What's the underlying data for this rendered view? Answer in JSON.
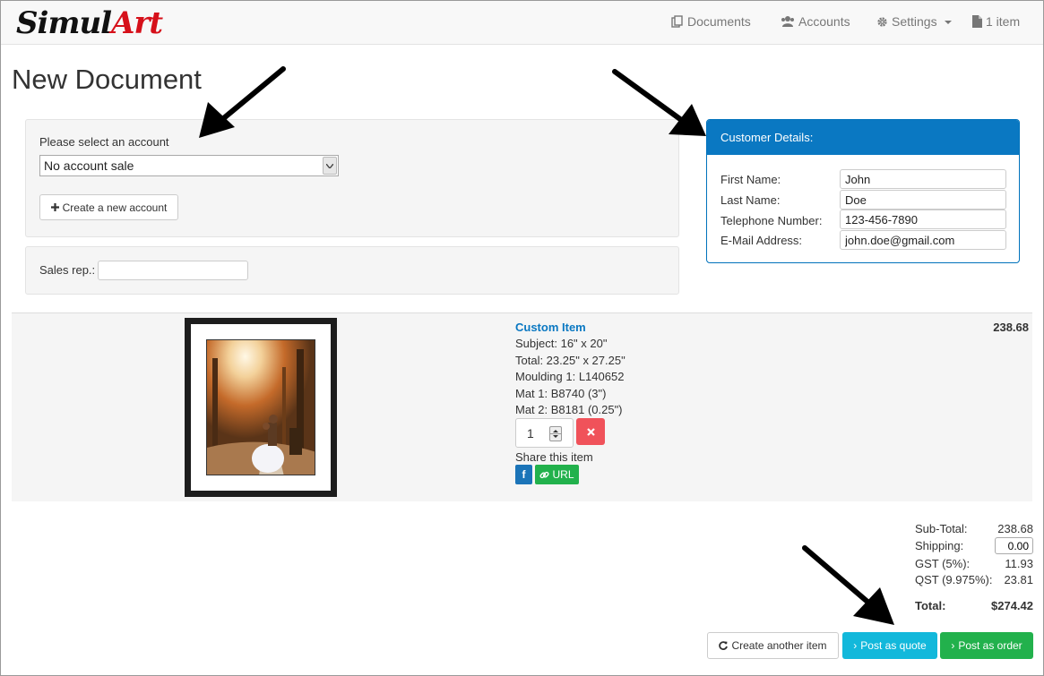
{
  "brand": {
    "part1": "Simul",
    "part2": "Art"
  },
  "nav": {
    "documents": "Documents",
    "accounts": "Accounts",
    "settings": "Settings",
    "cart": "1 item"
  },
  "page": {
    "title": "New Document"
  },
  "account": {
    "label": "Please select an account",
    "selected": "No account sale",
    "create_label": "Create a new account"
  },
  "sales_rep": {
    "label": "Sales rep.:",
    "value": ""
  },
  "customer": {
    "heading": "Customer Details:",
    "first_name_label": "First Name:",
    "first_name": "John",
    "last_name_label": "Last Name:",
    "last_name": "Doe",
    "phone_label": "Telephone Number:",
    "phone": "123-456-7890",
    "email_label": "E-Mail Address:",
    "email": "john.doe@gmail.com"
  },
  "item": {
    "title": "Custom Item",
    "subject": "Subject: 16\" x 20\"",
    "total": "Total: 23.25\" x 27.25\"",
    "moulding": "Moulding 1: L140652",
    "mat1": "Mat 1: B8740 (3\")",
    "mat2": "Mat 2: B8181 (0.25\")",
    "quantity": "1",
    "share_label": "Share this item",
    "url_label": "URL",
    "fb_label": "f",
    "price": "238.68"
  },
  "totals": {
    "subtotal_label": "Sub-Total:",
    "subtotal": "238.68",
    "shipping_label": "Shipping:",
    "shipping": "0.00",
    "gst_label": "GST (5%):",
    "gst": "11.93",
    "qst_label": "QST (9.975%):",
    "qst": "23.81",
    "total_label": "Total:",
    "total": "$274.42"
  },
  "actions": {
    "create_another": "Create another item",
    "post_quote": "Post as quote",
    "post_order": "Post as order"
  },
  "colors": {
    "primary": "#0a78c2",
    "brand_red": "#d6101a",
    "danger": "#f0525a",
    "success": "#22b14c",
    "info": "#12b8db",
    "facebook": "#1b74b8"
  }
}
